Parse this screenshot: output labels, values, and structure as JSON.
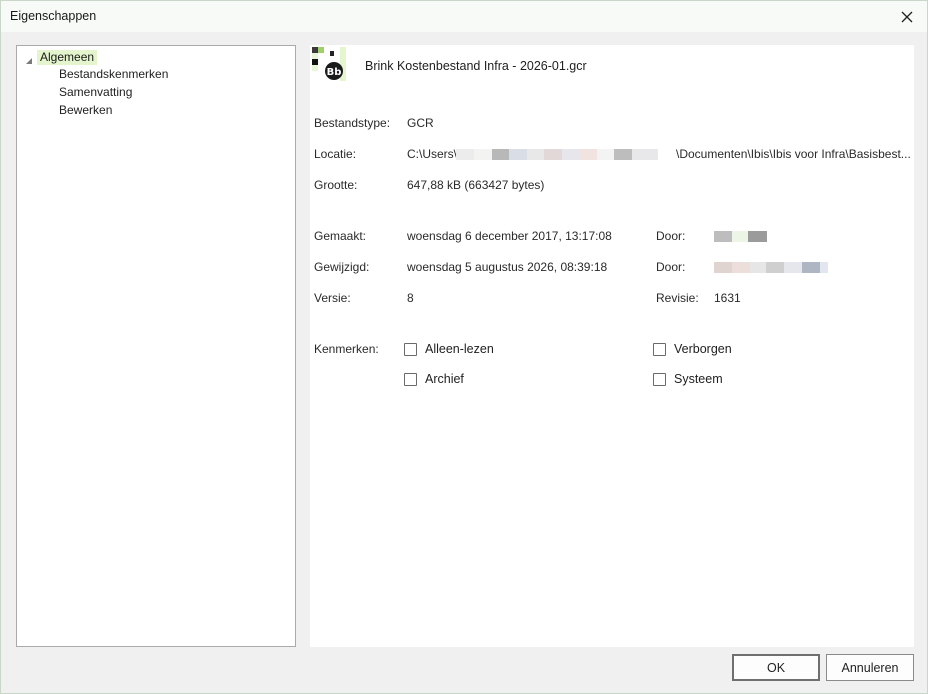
{
  "window": {
    "title": "Eigenschappen"
  },
  "tree": {
    "root": {
      "label": "Algemeen"
    },
    "children": [
      {
        "label": "Bestandskenmerken"
      },
      {
        "label": "Samenvatting"
      },
      {
        "label": "Bewerken"
      }
    ]
  },
  "file": {
    "name": "Brink Kostenbestand Infra - 2026-01.gcr",
    "icon": "bb-file-icon"
  },
  "properties": {
    "type_label": "Bestandstype:",
    "type_value": "GCR",
    "location_label": "Locatie:",
    "location_prefix": "C:\\Users\\",
    "location_suffix": "\\Documenten\\Ibis\\Ibis voor Infra\\Basisbest...",
    "size_label": "Grootte:",
    "size_value": "647,88 kB (663427 bytes)",
    "created_label": "Gemaakt:",
    "created_value": "woensdag 6 december 2017, 13:17:08",
    "created_by_label": "Door:",
    "modified_label": "Gewijzigd:",
    "modified_value": "woensdag 5 augustus 2026, 08:39:18",
    "modified_by_label": "Door:",
    "version_label": "Versie:",
    "version_value": "8",
    "revision_label": "Revisie:",
    "revision_value": "1631"
  },
  "attributes": {
    "label": "Kenmerken:",
    "read_only": {
      "label": "Alleen-lezen",
      "checked": false
    },
    "hidden": {
      "label": "Verborgen",
      "checked": false
    },
    "archive": {
      "label": "Archief",
      "checked": false
    },
    "system": {
      "label": "Systeem",
      "checked": false
    }
  },
  "buttons": {
    "ok": "OK",
    "cancel": "Annuleren"
  }
}
